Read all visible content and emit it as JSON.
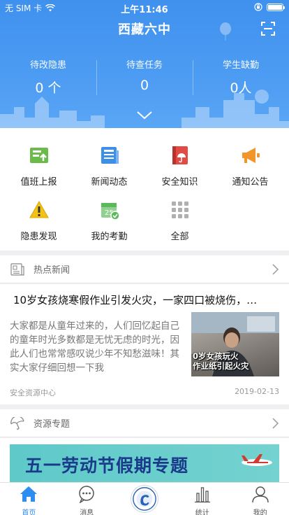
{
  "status_bar": {
    "carrier": "无 SIM 卡",
    "time": "上午11:46"
  },
  "header": {
    "title": "西藏六中"
  },
  "stats": [
    {
      "label": "待改隐患",
      "value": "0 个"
    },
    {
      "label": "待查任务",
      "value": "0"
    },
    {
      "label": "学生缺勤",
      "value": "0人"
    }
  ],
  "menu": [
    {
      "label": "值班上报",
      "icon": "duty-report-icon",
      "color": "#6abb4a"
    },
    {
      "label": "新闻动态",
      "icon": "news-icon",
      "color": "#3e8fe6"
    },
    {
      "label": "安全知识",
      "icon": "safety-knowledge-icon",
      "color": "#e24a44"
    },
    {
      "label": "通知公告",
      "icon": "megaphone-icon",
      "color": "#f2962c"
    },
    {
      "label": "隐患发现",
      "icon": "warning-icon",
      "color": "#f2c316"
    },
    {
      "label": "我的考勤",
      "icon": "calendar-check-icon",
      "color": "#5cb85c"
    },
    {
      "label": "全部",
      "icon": "grid-icon",
      "color": "#b0b0b0"
    }
  ],
  "hot_news": {
    "title": "热点新闻",
    "article": {
      "headline": "10岁女孩烧寒假作业引发火灾，一家四口被烧伤，…",
      "summary": "大家都是从童年过来的，人们回忆起自己的童年时光多数都是无忧无虑的时光，因此人们也常常感叹说少年不知愁滋味！其实大家仔细回想一下我",
      "thumb_caption_line1": "0岁女孩玩火",
      "thumb_caption_line2": "作业纸引起火灾",
      "source": "安全资源中心",
      "date": "2019-02-13"
    }
  },
  "resources": {
    "title": "资源专题",
    "banner_text": "五一劳动节假期专题"
  },
  "tabbar": [
    {
      "label": "首页",
      "icon": "home-icon",
      "active": true
    },
    {
      "label": "消息",
      "icon": "message-icon",
      "active": false
    },
    {
      "label": "",
      "icon": "school-logo-icon",
      "active": false
    },
    {
      "label": "统计",
      "icon": "stats-icon",
      "active": false
    },
    {
      "label": "我的",
      "icon": "profile-icon",
      "active": false
    }
  ],
  "colors": {
    "primary": "#4a98f1",
    "active_tab": "#2f8cf0"
  }
}
